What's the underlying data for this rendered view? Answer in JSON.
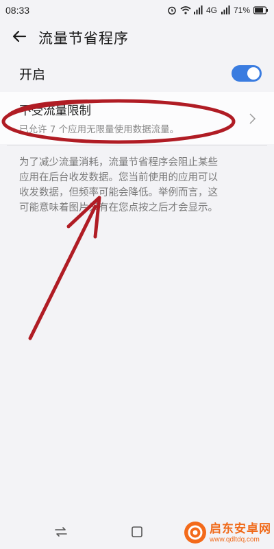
{
  "status_bar": {
    "time": "08:33",
    "network": "4G",
    "battery": "71%",
    "icons": [
      "alarm-icon",
      "wifi-icon",
      "signal-icon",
      "battery-icon"
    ]
  },
  "header": {
    "title": "流量节省程序",
    "back_icon": "arrow-left-icon"
  },
  "toggle": {
    "label": "开启",
    "enabled": true,
    "accent_color": "#3a7ce0"
  },
  "unrestricted": {
    "title": "不受流量限制",
    "subtitle": "已允许 7 个应用无限量使用数据流量。",
    "icon": "chevron-right-icon"
  },
  "description": {
    "lines": [
      "为了减少流量消耗，流量节省程序会阻止某些",
      "应用在后台收发数据。您当前使用的应用可以",
      "收发数据，但频率可能会降低。举例而言，这",
      "可能意味着图片只有在您点按之后才会显示。"
    ]
  },
  "nav_bar": {
    "items": [
      "recents-switch-icon",
      "home-square-icon",
      "back-nav-icon"
    ]
  },
  "annotation_color": "#b01c24",
  "watermark": {
    "title": "启东安卓网",
    "url": "www.qdltdq.com"
  }
}
